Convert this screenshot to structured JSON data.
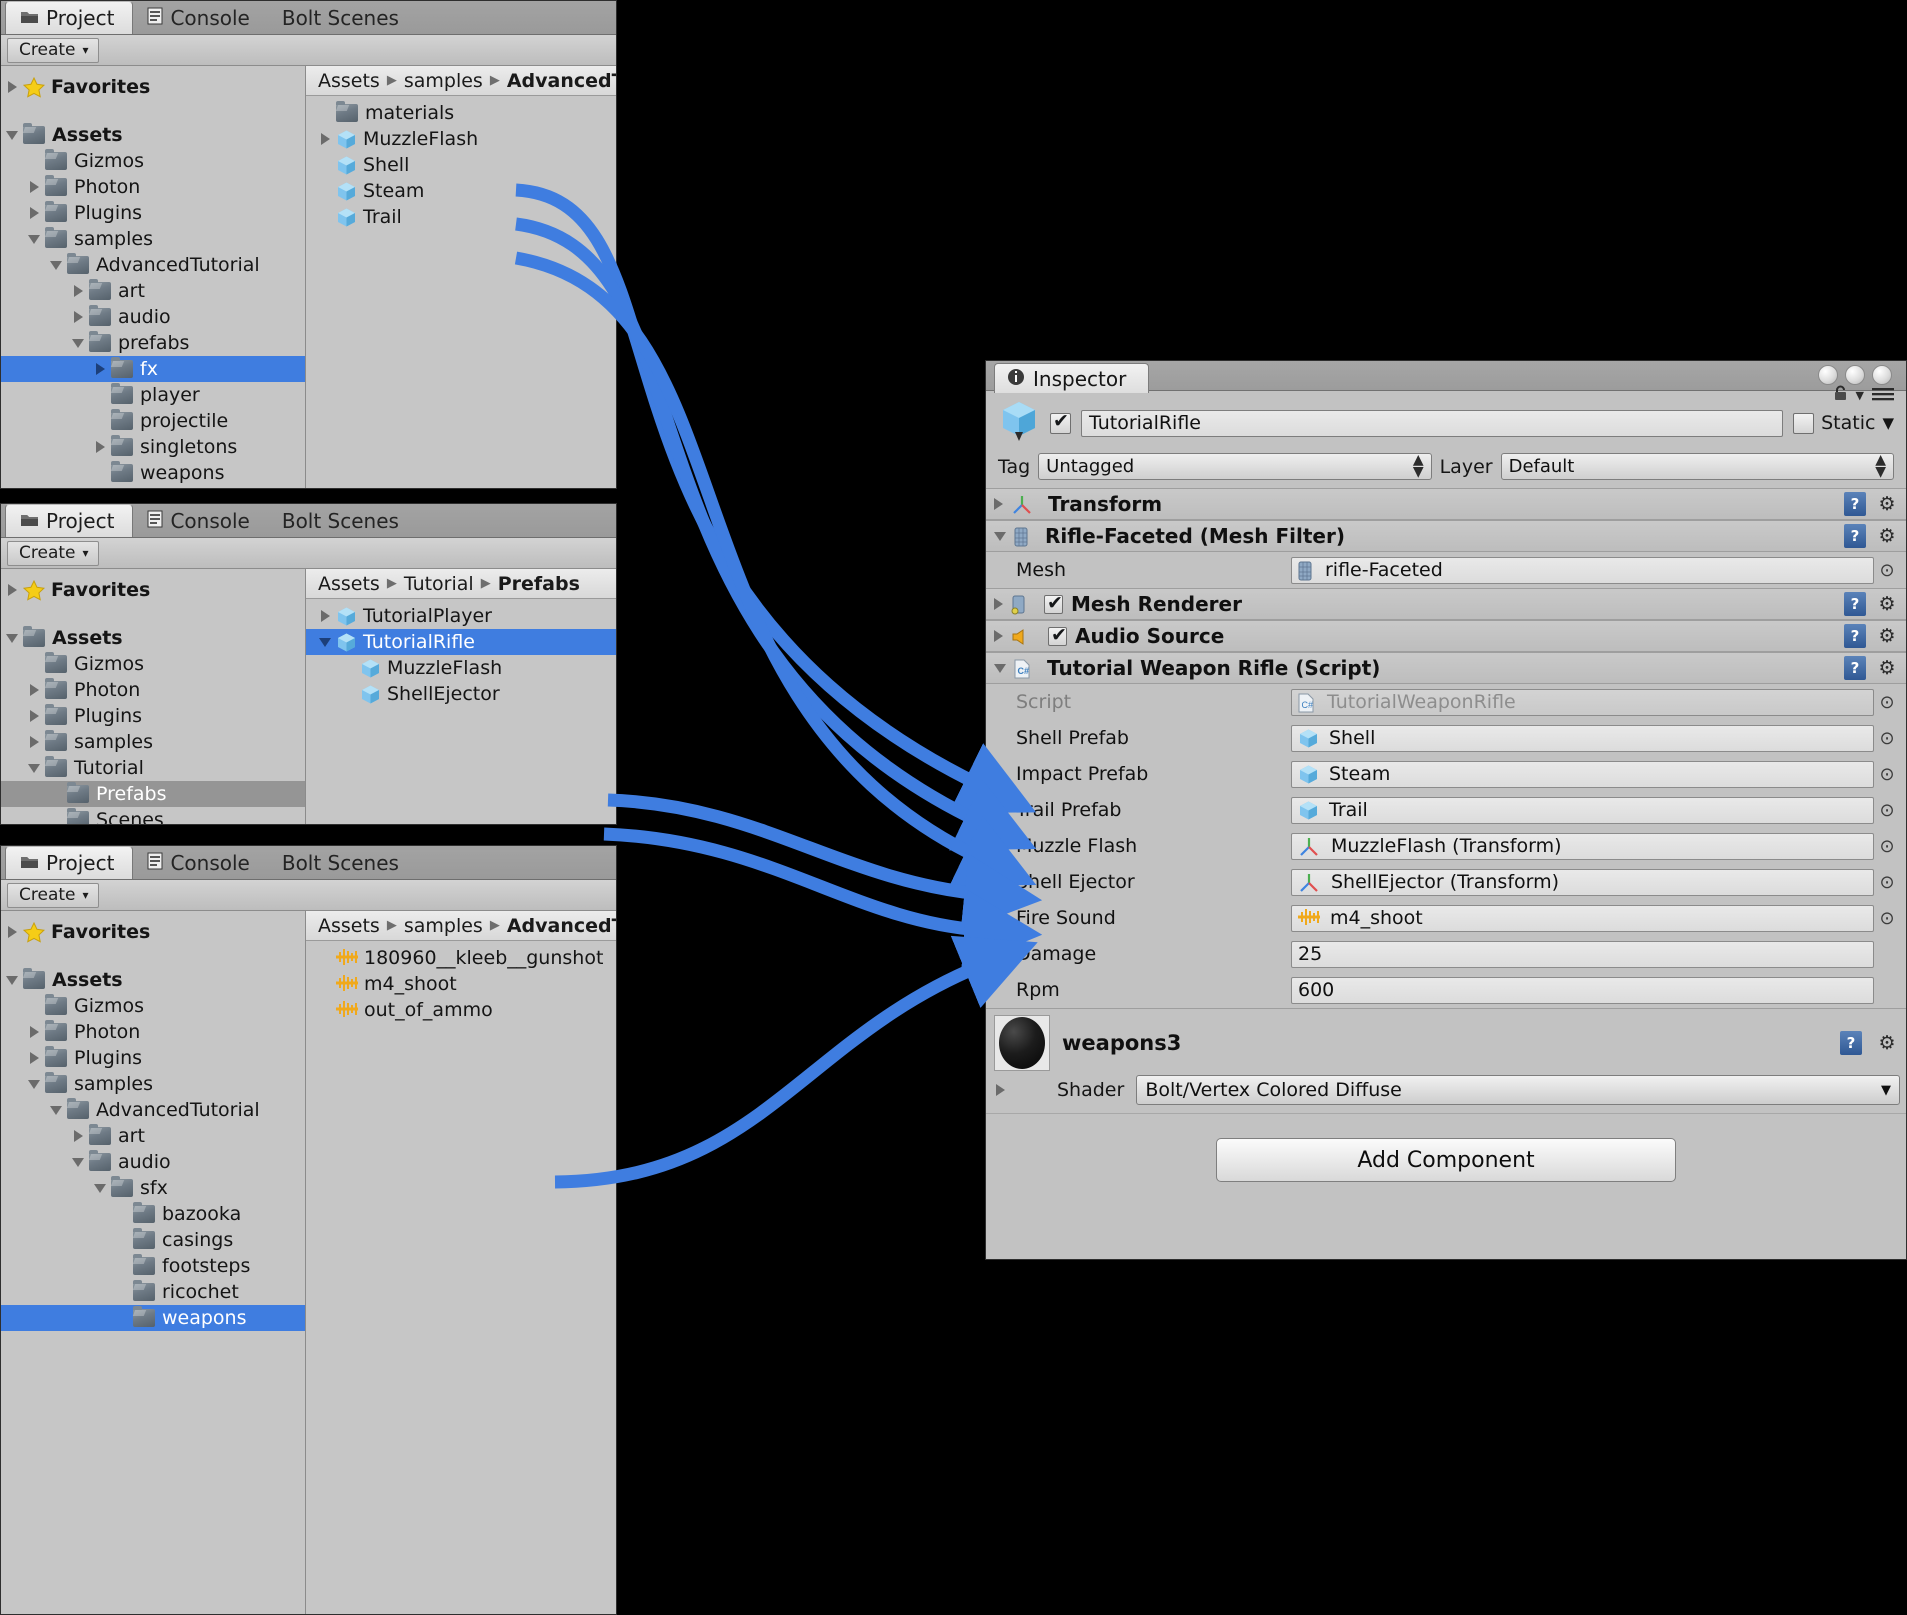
{
  "accent": {
    "selection_blue": "#3f7de0",
    "arrow_blue": "#3f7de0",
    "panel_grey": "#c2c2c2"
  },
  "panels": {
    "project_top": {
      "tabs": [
        {
          "label": "Project",
          "icon": "folder-tab-icon",
          "active": true
        },
        {
          "label": "Console",
          "icon": "console-tab-icon",
          "active": false
        },
        {
          "label": "Bolt Scenes",
          "icon": "",
          "active": false
        }
      ],
      "toolbar": {
        "create_label": "Create",
        "create_caret": "▾"
      },
      "tree": [
        {
          "label": "Favorites",
          "indent": 0,
          "twisty": "closed",
          "icon": "star-icon",
          "bold": true,
          "selected": "none"
        },
        {
          "label": "",
          "indent": 0,
          "twisty": "none",
          "icon": "spacer",
          "bold": false,
          "selected": "none"
        },
        {
          "label": "Assets",
          "indent": 0,
          "twisty": "open",
          "icon": "folder-icon",
          "bold": true,
          "selected": "none"
        },
        {
          "label": "Gizmos",
          "indent": 1,
          "twisty": "none",
          "icon": "folder-icon",
          "bold": false,
          "selected": "none"
        },
        {
          "label": "Photon",
          "indent": 1,
          "twisty": "closed",
          "icon": "folder-icon",
          "bold": false,
          "selected": "none"
        },
        {
          "label": "Plugins",
          "indent": 1,
          "twisty": "closed",
          "icon": "folder-icon",
          "bold": false,
          "selected": "none"
        },
        {
          "label": "samples",
          "indent": 1,
          "twisty": "open",
          "icon": "folder-icon",
          "bold": false,
          "selected": "none"
        },
        {
          "label": "AdvancedTutorial",
          "indent": 2,
          "twisty": "open",
          "icon": "folder-icon",
          "bold": false,
          "selected": "none"
        },
        {
          "label": "art",
          "indent": 3,
          "twisty": "closed",
          "icon": "folder-icon",
          "bold": false,
          "selected": "none"
        },
        {
          "label": "audio",
          "indent": 3,
          "twisty": "closed",
          "icon": "folder-icon",
          "bold": false,
          "selected": "none"
        },
        {
          "label": "prefabs",
          "indent": 3,
          "twisty": "open",
          "icon": "folder-icon",
          "bold": false,
          "selected": "none"
        },
        {
          "label": "fx",
          "indent": 4,
          "twisty": "closed",
          "icon": "folder-icon",
          "bold": false,
          "selected": "blue"
        },
        {
          "label": "player",
          "indent": 4,
          "twisty": "none",
          "icon": "folder-icon",
          "bold": false,
          "selected": "none"
        },
        {
          "label": "projectile",
          "indent": 4,
          "twisty": "none",
          "icon": "folder-icon",
          "bold": false,
          "selected": "none"
        },
        {
          "label": "singletons",
          "indent": 4,
          "twisty": "closed",
          "icon": "folder-icon",
          "bold": false,
          "selected": "none"
        },
        {
          "label": "weapons",
          "indent": 4,
          "twisty": "none",
          "icon": "folder-icon",
          "bold": false,
          "selected": "none"
        }
      ],
      "breadcrumb": [
        {
          "label": "Assets",
          "bold": false
        },
        {
          "label": "samples",
          "bold": false
        },
        {
          "label": "AdvancedTu",
          "bold": true
        }
      ],
      "items": [
        {
          "label": "materials",
          "icon": "folder-icon",
          "twisty": "none"
        },
        {
          "label": "MuzzleFlash",
          "icon": "prefab-icon",
          "twisty": "closed"
        },
        {
          "label": "Shell",
          "icon": "prefab-icon",
          "twisty": "none"
        },
        {
          "label": "Steam",
          "icon": "prefab-icon",
          "twisty": "none"
        },
        {
          "label": "Trail",
          "icon": "prefab-icon",
          "twisty": "none"
        }
      ]
    },
    "project_mid": {
      "tabs": [
        {
          "label": "Project",
          "icon": "folder-tab-icon",
          "active": true
        },
        {
          "label": "Console",
          "icon": "console-tab-icon",
          "active": false
        },
        {
          "label": "Bolt Scenes",
          "icon": "",
          "active": false
        }
      ],
      "toolbar": {
        "create_label": "Create",
        "create_caret": "▾"
      },
      "tree": [
        {
          "label": "Favorites",
          "indent": 0,
          "twisty": "closed",
          "icon": "star-icon",
          "bold": true,
          "selected": "none"
        },
        {
          "label": "",
          "indent": 0,
          "twisty": "none",
          "icon": "spacer",
          "bold": false,
          "selected": "none"
        },
        {
          "label": "Assets",
          "indent": 0,
          "twisty": "open",
          "icon": "folder-icon",
          "bold": true,
          "selected": "none"
        },
        {
          "label": "Gizmos",
          "indent": 1,
          "twisty": "none",
          "icon": "folder-icon",
          "bold": false,
          "selected": "none"
        },
        {
          "label": "Photon",
          "indent": 1,
          "twisty": "closed",
          "icon": "folder-icon",
          "bold": false,
          "selected": "none"
        },
        {
          "label": "Plugins",
          "indent": 1,
          "twisty": "closed",
          "icon": "folder-icon",
          "bold": false,
          "selected": "none"
        },
        {
          "label": "samples",
          "indent": 1,
          "twisty": "closed",
          "icon": "folder-icon",
          "bold": false,
          "selected": "none"
        },
        {
          "label": "Tutorial",
          "indent": 1,
          "twisty": "open",
          "icon": "folder-icon",
          "bold": false,
          "selected": "none"
        },
        {
          "label": "Prefabs",
          "indent": 2,
          "twisty": "none",
          "icon": "folder-icon",
          "bold": false,
          "selected": "grey"
        },
        {
          "label": "Scenes",
          "indent": 2,
          "twisty": "none",
          "icon": "folder-icon",
          "bold": false,
          "selected": "none"
        }
      ],
      "breadcrumb": [
        {
          "label": "Assets",
          "bold": false
        },
        {
          "label": "Tutorial",
          "bold": false
        },
        {
          "label": "Prefabs",
          "bold": true
        }
      ],
      "items": [
        {
          "label": "TutorialPlayer",
          "icon": "prefab-icon",
          "twisty": "closed",
          "indent": 0,
          "selected": "none"
        },
        {
          "label": "TutorialRifle",
          "icon": "prefab-icon",
          "twisty": "open",
          "indent": 0,
          "selected": "blue"
        },
        {
          "label": "MuzzleFlash",
          "icon": "prefab-icon",
          "twisty": "none",
          "indent": 1,
          "selected": "none"
        },
        {
          "label": "ShellEjector",
          "icon": "prefab-icon",
          "twisty": "none",
          "indent": 1,
          "selected": "none"
        }
      ]
    },
    "project_bot": {
      "tabs": [
        {
          "label": "Project",
          "icon": "folder-tab-icon",
          "active": true
        },
        {
          "label": "Console",
          "icon": "console-tab-icon",
          "active": false
        },
        {
          "label": "Bolt Scenes",
          "icon": "",
          "active": false
        }
      ],
      "toolbar": {
        "create_label": "Create",
        "create_caret": "▾"
      },
      "tree": [
        {
          "label": "Favorites",
          "indent": 0,
          "twisty": "closed",
          "icon": "star-icon",
          "bold": true,
          "selected": "none"
        },
        {
          "label": "",
          "indent": 0,
          "twisty": "none",
          "icon": "spacer",
          "bold": false,
          "selected": "none"
        },
        {
          "label": "Assets",
          "indent": 0,
          "twisty": "open",
          "icon": "folder-icon",
          "bold": true,
          "selected": "none"
        },
        {
          "label": "Gizmos",
          "indent": 1,
          "twisty": "none",
          "icon": "folder-icon",
          "bold": false,
          "selected": "none"
        },
        {
          "label": "Photon",
          "indent": 1,
          "twisty": "closed",
          "icon": "folder-icon",
          "bold": false,
          "selected": "none"
        },
        {
          "label": "Plugins",
          "indent": 1,
          "twisty": "closed",
          "icon": "folder-icon",
          "bold": false,
          "selected": "none"
        },
        {
          "label": "samples",
          "indent": 1,
          "twisty": "open",
          "icon": "folder-icon",
          "bold": false,
          "selected": "none"
        },
        {
          "label": "AdvancedTutorial",
          "indent": 2,
          "twisty": "open",
          "icon": "folder-icon",
          "bold": false,
          "selected": "none"
        },
        {
          "label": "art",
          "indent": 3,
          "twisty": "closed",
          "icon": "folder-icon",
          "bold": false,
          "selected": "none"
        },
        {
          "label": "audio",
          "indent": 3,
          "twisty": "open",
          "icon": "folder-icon",
          "bold": false,
          "selected": "none"
        },
        {
          "label": "sfx",
          "indent": 4,
          "twisty": "open",
          "icon": "folder-icon",
          "bold": false,
          "selected": "none"
        },
        {
          "label": "bazooka",
          "indent": 5,
          "twisty": "none",
          "icon": "folder-icon",
          "bold": false,
          "selected": "none"
        },
        {
          "label": "casings",
          "indent": 5,
          "twisty": "none",
          "icon": "folder-icon",
          "bold": false,
          "selected": "none"
        },
        {
          "label": "footsteps",
          "indent": 5,
          "twisty": "none",
          "icon": "folder-icon",
          "bold": false,
          "selected": "none"
        },
        {
          "label": "ricochet",
          "indent": 5,
          "twisty": "none",
          "icon": "folder-icon",
          "bold": false,
          "selected": "none"
        },
        {
          "label": "weapons",
          "indent": 5,
          "twisty": "none",
          "icon": "folder-icon",
          "bold": false,
          "selected": "blue"
        }
      ],
      "breadcrumb": [
        {
          "label": "Assets",
          "bold": false
        },
        {
          "label": "samples",
          "bold": false
        },
        {
          "label": "AdvancedTu",
          "bold": true
        }
      ],
      "items": [
        {
          "label": "180960__kleeb__gunshot",
          "icon": "audio-icon",
          "twisty": "none"
        },
        {
          "label": "m4_shoot",
          "icon": "audio-icon",
          "twisty": "none"
        },
        {
          "label": "out_of_ammo",
          "icon": "audio-icon",
          "twisty": "none"
        }
      ]
    }
  },
  "inspector": {
    "tab_label": "Inspector",
    "tab_icon": "info-icon",
    "window_buttons": [
      "minimize-dot",
      "maximize-dot",
      "close-dot"
    ],
    "lock_icon": "lock-icon",
    "menu_icon": "hamburger-menu-icon",
    "object": {
      "icon": "prefab-icon",
      "enabled": true,
      "name": "TutorialRifle",
      "static_label": "Static",
      "static_checked": false,
      "tag_label": "Tag",
      "tag_value": "Untagged",
      "layer_label": "Layer",
      "layer_value": "Default"
    },
    "components": [
      {
        "name": "Transform",
        "icon": "transform-icon",
        "expanded": false,
        "has_toggle": false,
        "enabled": false
      },
      {
        "name": "Rifle-Faceted (Mesh Filter)",
        "icon": "mesh-filter-icon",
        "expanded": true,
        "has_toggle": false,
        "enabled": false
      },
      {
        "name": "Mesh Renderer",
        "icon": "mesh-renderer-icon",
        "expanded": false,
        "has_toggle": true,
        "enabled": true
      },
      {
        "name": "Audio Source",
        "icon": "audio-source-icon",
        "expanded": false,
        "has_toggle": true,
        "enabled": true
      },
      {
        "name": "Tutorial Weapon Rifle (Script)",
        "icon": "csharp-script-icon",
        "expanded": true,
        "has_toggle": false,
        "enabled": false
      }
    ],
    "mesh_filter_props": [
      {
        "label": "Mesh",
        "value": "rifle-Faceted",
        "icon": "mesh-icon",
        "kind": "object",
        "dim": false,
        "picker": true
      }
    ],
    "script_props": [
      {
        "label": "Script",
        "value": "TutorialWeaponRifle",
        "icon": "csharp-script-icon",
        "kind": "object",
        "dim": true,
        "picker": true
      },
      {
        "label": "Shell Prefab",
        "value": "Shell",
        "icon": "prefab-icon",
        "kind": "object",
        "dim": false,
        "picker": true
      },
      {
        "label": "Impact Prefab",
        "value": "Steam",
        "icon": "prefab-icon",
        "kind": "object",
        "dim": false,
        "picker": true
      },
      {
        "label": "Trail Prefab",
        "value": "Trail",
        "icon": "prefab-icon",
        "kind": "object",
        "dim": false,
        "picker": true
      },
      {
        "label": "Muzzle Flash",
        "value": "MuzzleFlash (Transform)",
        "icon": "transform-icon",
        "kind": "object",
        "dim": false,
        "picker": true
      },
      {
        "label": "Shell Ejector",
        "value": "ShellEjector (Transform)",
        "icon": "transform-icon",
        "kind": "object",
        "dim": false,
        "picker": true
      },
      {
        "label": "Fire Sound",
        "value": "m4_shoot",
        "icon": "audio-icon",
        "kind": "object",
        "dim": false,
        "picker": true
      },
      {
        "label": "Damage",
        "value": "25",
        "icon": "",
        "kind": "number",
        "dim": false,
        "picker": false
      },
      {
        "label": "Rpm",
        "value": "600",
        "icon": "",
        "kind": "number",
        "dim": false,
        "picker": false
      }
    ],
    "material": {
      "name": "weapons3",
      "shader_label": "Shader",
      "shader_value": "Bolt/Vertex Colored Diffuse",
      "thumb_icon": "material-sphere-icon"
    },
    "add_component_label": "Add Component"
  }
}
